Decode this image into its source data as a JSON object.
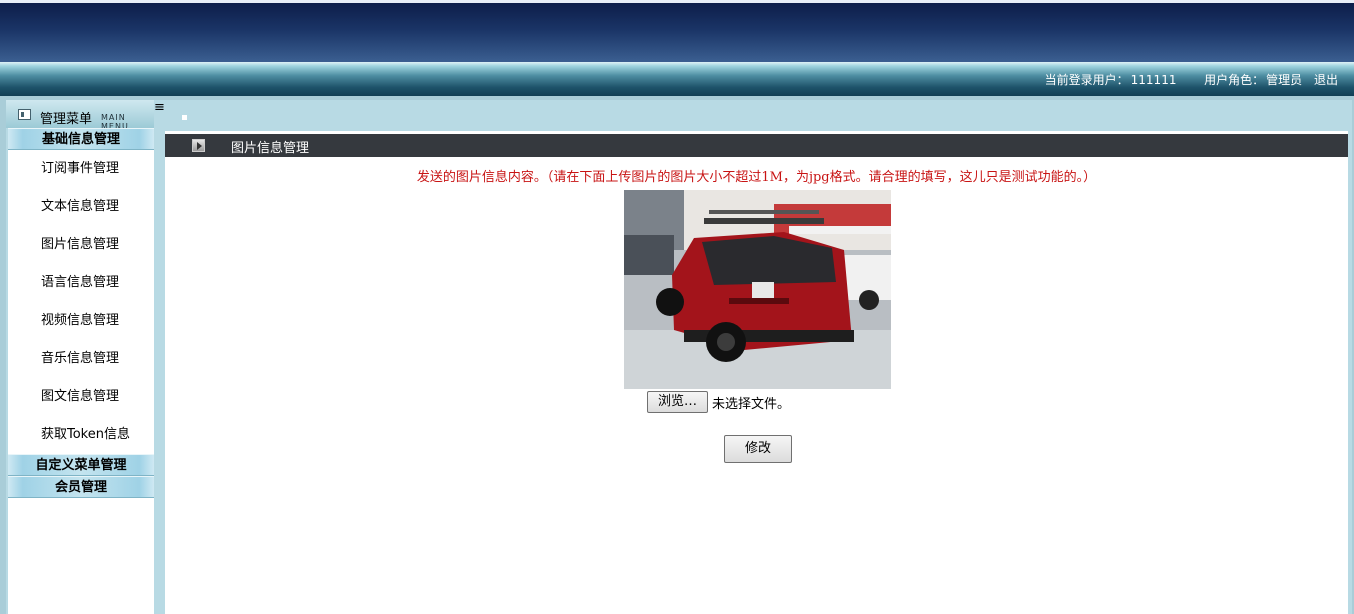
{
  "header": {
    "current_user_label": "当前登录用户：",
    "current_user": "111111",
    "role_label": "用户角色：",
    "role": "管理员",
    "logout": "退出"
  },
  "menu": {
    "title": "管理菜单",
    "title_en": "MAIN MENU"
  },
  "sidebar": {
    "section_basic": "基础信息管理",
    "items": [
      "订阅事件管理",
      "文本信息管理",
      "图片信息管理",
      "语言信息管理",
      "视频信息管理",
      "音乐信息管理",
      "图文信息管理",
      "获取Token信息"
    ],
    "section_custom_menu": "自定义菜单管理",
    "section_members": "会员管理"
  },
  "content": {
    "header_title": "图片信息管理",
    "notice": "发送的图片信息内容。（请在下面上传图片的图片大小不超过1M，为jpg格式。请合理的填写，这儿只是测试功能的。）",
    "browse_button": "浏览…",
    "no_file": "未选择文件。",
    "submit_button": "修改"
  },
  "colors": {
    "banner": "#1a3466",
    "notice_text": "#c81414",
    "content_bar": "#35393e",
    "car": "#a3141b"
  },
  "icons": {
    "menu": "menu-panel-icon",
    "header": "play-arrow-icon"
  }
}
